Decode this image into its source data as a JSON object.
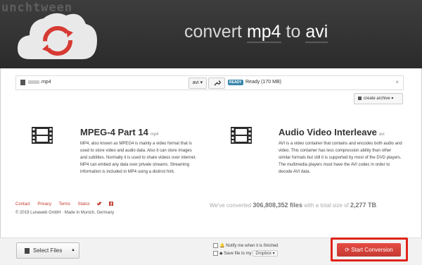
{
  "watermark": "unchtween",
  "header": {
    "title_prefix": "convert ",
    "from_format": "mp4",
    "title_middle": " to ",
    "to_format": "avi"
  },
  "file_row": {
    "file_name": ".mp4",
    "target_format": "avi ▾",
    "status_badge": "READY",
    "status_text": "Ready (170 MB)",
    "close": "×"
  },
  "create_archive": "create archive ▾",
  "info": [
    {
      "title": "MPEG-4 Part 14",
      "ext": "mp4",
      "description": "MP4, also known as MPEG4 is mainly a video format that is used to store video and audio data. Also it can store images and subtitles. Normally it is used to share videos over internet. MP4 can embed any data over private streams. Streaming information is included in MP4 using a distinct hint."
    },
    {
      "title": "Audio Video Interleave",
      "ext": "avi",
      "description": "AVI is a video container that contains and encodes both audio and video. This container has less compression ability than other similar formats but still it is supported by most of the DVD players. The multimedia players must have the AVI codec in order to decode AVI data."
    }
  ],
  "footer": {
    "links": [
      "Contact",
      "Privacy",
      "Terms",
      "Status"
    ],
    "copyright": "© 2019 Lunaweb GmbH · Made in Munich, Germany",
    "stats_prefix": "We've converted ",
    "files_count": "306,808,352 files",
    "stats_middle": " with a total size of ",
    "total_size": "2,277 TB",
    "stats_suffix": "."
  },
  "bottom": {
    "select_files": "Select Files",
    "notify_label": "Notify me when it is finished",
    "save_label": "Save file to my",
    "dropbox": "Dropbox ▾",
    "start_conversion": "Start Conversion"
  },
  "colors": {
    "accent": "#c0392b",
    "button": "#d9443d",
    "highlight": "#e0231b",
    "badge": "#3a87ad"
  }
}
